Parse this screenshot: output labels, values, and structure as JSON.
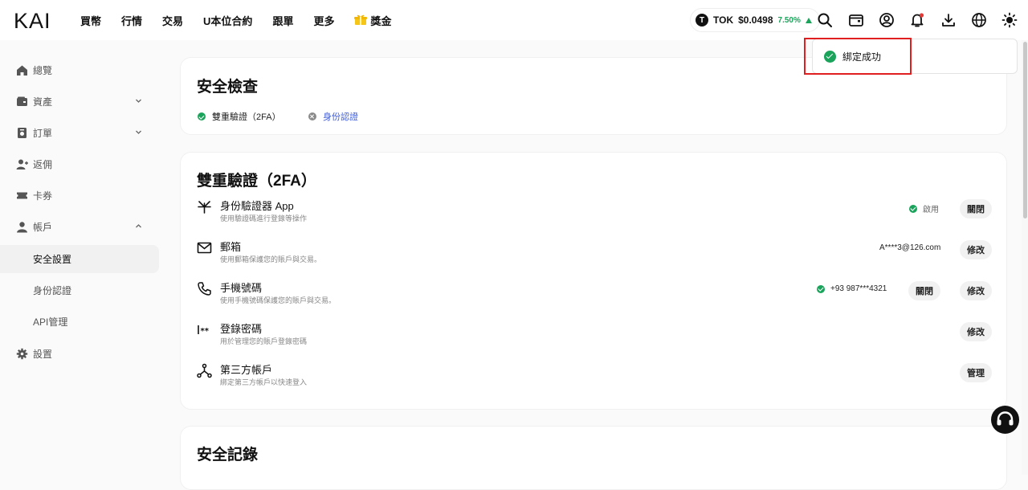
{
  "app": {
    "logo_text": "KAI"
  },
  "nav": {
    "items": [
      "買幣",
      "行情",
      "交易",
      "U本位合約",
      "跟單",
      "更多"
    ],
    "reward_label": "獎金"
  },
  "ticker": {
    "symbol": "TOK",
    "price": "$0.0498",
    "change": "7.50%"
  },
  "toast": {
    "message": "綁定成功"
  },
  "sidebar": {
    "items": [
      {
        "label": "總覽",
        "icon": "home-icon"
      },
      {
        "label": "資產",
        "icon": "wallet-icon",
        "expandable": true
      },
      {
        "label": "訂單",
        "icon": "order-icon",
        "expandable": true
      },
      {
        "label": "返佣",
        "icon": "referral-icon"
      },
      {
        "label": "卡券",
        "icon": "ticket-icon"
      },
      {
        "label": "帳戶",
        "icon": "user-icon",
        "expanded": true
      }
    ],
    "account_sub": [
      "安全設置",
      "身份認證",
      "API管理"
    ],
    "settings_label": "設置"
  },
  "security_check": {
    "title": "安全檢查",
    "items": [
      {
        "label": "雙重驗證（2FA）",
        "status": "done"
      },
      {
        "label": "身份認證",
        "status": "pending"
      }
    ]
  },
  "two_fa": {
    "title": "雙重驗證（2FA）",
    "rows": [
      {
        "title": "身份驗證器 App",
        "desc": "使用驗證碼進行登錄等操作",
        "status_text": "啟用",
        "buttons": [
          "關閉"
        ]
      },
      {
        "title": "郵箱",
        "desc": "使用郵箱保護您的賬戶與交易。",
        "value": "A****3@126.com",
        "buttons": [
          "修改"
        ]
      },
      {
        "title": "手機號碼",
        "desc": "使用手機號碼保護您的賬戶與交易。",
        "status_text": "+93 987***4321",
        "buttons": [
          "關閉",
          "修改"
        ]
      },
      {
        "title": "登錄密碼",
        "desc": "用於管理您的賬戶登錄密碼",
        "buttons": [
          "修改"
        ]
      },
      {
        "title": "第三方帳戶",
        "desc": "綁定第三方帳戶以快速登入",
        "buttons": [
          "管理"
        ]
      }
    ]
  },
  "security_log": {
    "title": "安全記錄"
  },
  "colors": {
    "accent_green": "#1aa35a",
    "link_blue": "#3b5bdb",
    "highlight_red": "#e02020"
  }
}
